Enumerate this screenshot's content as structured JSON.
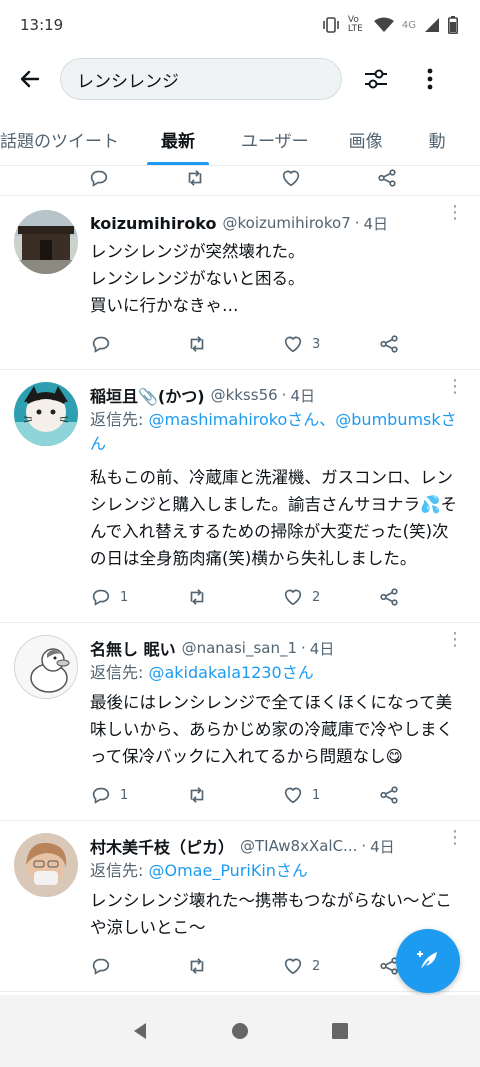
{
  "status": {
    "time": "13:19",
    "network_label": "4G",
    "volte_label": "Vo LTE"
  },
  "search": {
    "query": "レンシレンジ"
  },
  "tabs": [
    {
      "label": "話題のツイート",
      "active": false
    },
    {
      "label": "最新",
      "active": true
    },
    {
      "label": "ユーザー",
      "active": false
    },
    {
      "label": "画像",
      "active": false
    },
    {
      "label": "動",
      "active": false
    }
  ],
  "tweets": [
    {
      "name": "koizumihiroko",
      "handle": "@koizumihiroko7",
      "time": "4日",
      "reply_prefix": "",
      "reply_to": "",
      "text": "レンシレンジが突然壊れた。\nレンシレンジがないと困る。\n買いに行かなきゃ…",
      "replies": "",
      "retweets": "",
      "likes": "3"
    },
    {
      "name": "稲垣且📎(かつ)",
      "handle": "@kkss56",
      "time": "4日",
      "reply_prefix": "返信先: ",
      "reply_to": "@mashimahirokoさん、@bumbumskさん",
      "text": "私もこの前、冷蔵庫と洗濯機、ガスコンロ、レンシレンジと購入しました。諭吉さんサヨナラ💦そんで入れ替えするための掃除が大変だった(笑)次の日は全身筋肉痛(笑)横から失礼しました。",
      "replies": "1",
      "retweets": "",
      "likes": "2"
    },
    {
      "name": "名無し 眠い",
      "handle": "@nanasi_san_1",
      "time": "4日",
      "reply_prefix": "返信先: ",
      "reply_to": "@akidakala1230さん",
      "text": "最後にはレンシレンジで全てほくほくになって美味しいから、あらかじめ家の冷蔵庫で冷やしまくって保冷バックに入れてるから問題なし😋",
      "replies": "1",
      "retweets": "",
      "likes": "1"
    },
    {
      "name": "村木美千枝（ピカ）",
      "handle": "@TIAw8xXalC...",
      "time": "4日",
      "reply_prefix": "返信先: ",
      "reply_to": "@Omae_PuriKinさん",
      "text": "レンシレンジ壊れた〜携帯もつながらない〜どこや涼しいとこ〜",
      "replies": "",
      "retweets": "",
      "likes": "2"
    }
  ],
  "colors": {
    "accent": "#1d9bf0",
    "secondary_text": "#536471"
  }
}
